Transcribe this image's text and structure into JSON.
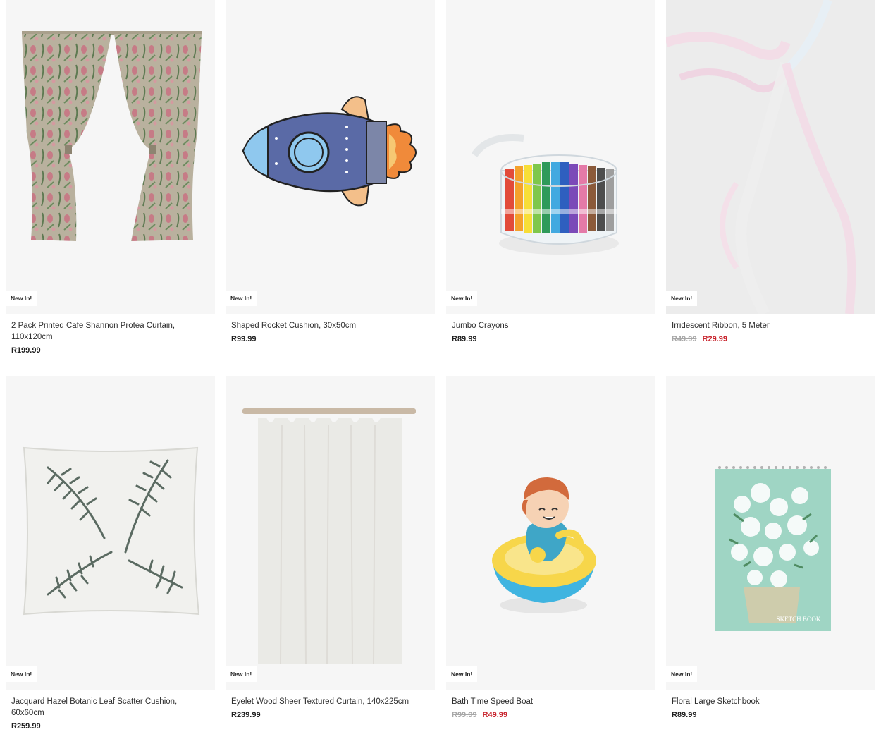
{
  "colors": {
    "sale": "#c8232c",
    "was": "#a7a7a7",
    "card_bg": "#f6f6f6",
    "text": "#2f2f2f"
  },
  "products": [
    {
      "badge": "New In!",
      "title": "2 Pack Printed Cafe Shannon Protea Curtain, 110x120cm",
      "price": "R199.99"
    },
    {
      "badge": "New In!",
      "title": "Shaped Rocket Cushion, 30x50cm",
      "price": "R99.99"
    },
    {
      "badge": "New In!",
      "title": "Jumbo Crayons",
      "price": "R89.99"
    },
    {
      "badge": "New In!",
      "title": "Irridescent Ribbon, 5 Meter",
      "was_price": "R49.99",
      "sale_price": "R29.99"
    },
    {
      "badge": "New In!",
      "title": "Jacquard Hazel Botanic Leaf Scatter Cushion, 60x60cm",
      "price": "R259.99"
    },
    {
      "badge": "New In!",
      "title": "Eyelet Wood Sheer Textured Curtain, 140x225cm",
      "price": "R239.99"
    },
    {
      "badge": "New In!",
      "title": "Bath Time Speed Boat",
      "was_price": "R99.99",
      "sale_price": "R49.99"
    },
    {
      "badge": "New In!",
      "title": "Floral Large Sketchbook",
      "price": "R89.99"
    }
  ],
  "sketchbook_cover_text": "SKETCH BOOK"
}
